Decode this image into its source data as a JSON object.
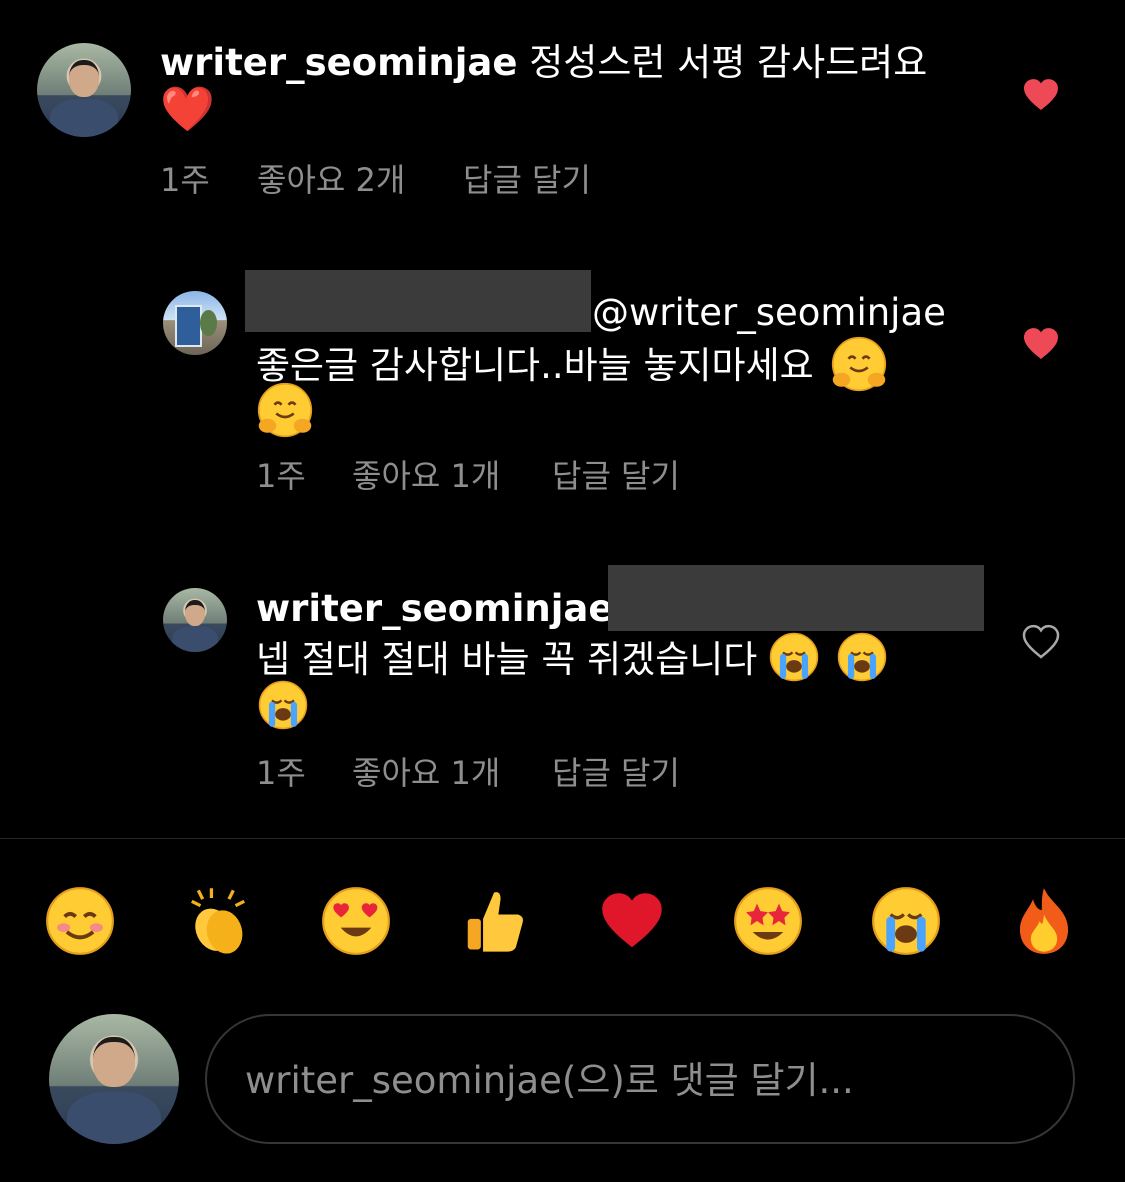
{
  "comments": [
    {
      "username": "writer_seominjae",
      "text": "정성스런 서평 감사드려요",
      "emoji_line": "❤️",
      "age": "1주",
      "likes": "좋아요 2개",
      "reply": "답글 달기",
      "liked": true
    },
    {
      "mention": "@writer_seominjae",
      "text": "좋은글 감사합니다..바늘 놓지마세요",
      "age": "1주",
      "likes": "좋아요 1개",
      "reply": "답글 달기",
      "liked": true
    },
    {
      "username": "writer_seominjae",
      "text": "넵 절대 절대 바늘 꼭 쥐겠습니다",
      "age": "1주",
      "likes": "좋아요 1개",
      "reply": "답글 달기",
      "liked": false
    }
  ],
  "quick_reactions": [
    "smiling-face",
    "clapping-hands",
    "heart-eyes",
    "thumbs-up",
    "red-heart",
    "star-struck",
    "loudly-crying",
    "fire"
  ],
  "composer": {
    "placeholder": "writer_seominjae(으)로 댓글 달기..."
  },
  "colors": {
    "liked_heart": "#ed4956",
    "muted_text": "#8e8e8e",
    "redaction": "#3b3b3b"
  }
}
